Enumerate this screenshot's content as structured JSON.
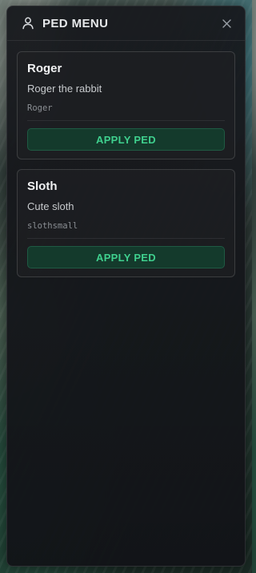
{
  "header": {
    "title": "PED MENU",
    "icon": "user-icon",
    "close_icon": "close-icon"
  },
  "peds": [
    {
      "name": "Roger",
      "description": "Roger the rabbit",
      "model": "Roger",
      "button_label": "APPLY PED"
    },
    {
      "name": "Sloth",
      "description": "Cute sloth",
      "model": "slothsmall",
      "button_label": "APPLY PED"
    }
  ],
  "colors": {
    "accent": "#3fd08e",
    "button_bg": "#143a2c",
    "panel_bg": "#16181c"
  }
}
